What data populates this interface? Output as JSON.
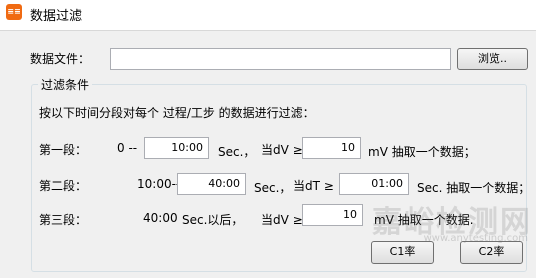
{
  "window": {
    "title": "数据过滤",
    "icon": "app-icon"
  },
  "file": {
    "label": "数据文件：",
    "value": "",
    "browse_label": "浏览.."
  },
  "group": {
    "title": "过滤条件",
    "instruction": "按以下时间分段对每个 过程/工步 的数据进行过滤："
  },
  "segments": [
    {
      "name": "第一段：",
      "start_prefix": "0 --",
      "time_value": "10:00",
      "time_unit": "Sec.，",
      "condition": "当dV ≥",
      "threshold_value": "10",
      "result_text": "mV 抽取一个数据；"
    },
    {
      "name": "第二段：",
      "start_prefix": "10:00--",
      "time_value": "40:00",
      "time_unit": "Sec.，",
      "condition": "当dT ≥",
      "threshold_value": "01:00",
      "result_text": "Sec. 抽取一个数据；"
    },
    {
      "name": "第三段：",
      "start_prefix": "40:00",
      "time_suffix": "Sec.以后，",
      "condition": "当dV ≥",
      "threshold_value": "10",
      "result_text": "mV 抽取一个数据."
    }
  ],
  "buttons": {
    "c1": "C1率",
    "c2": "C2率"
  },
  "watermark": {
    "main": "嘉峪检测网",
    "sub": "www.anytesting.com"
  }
}
